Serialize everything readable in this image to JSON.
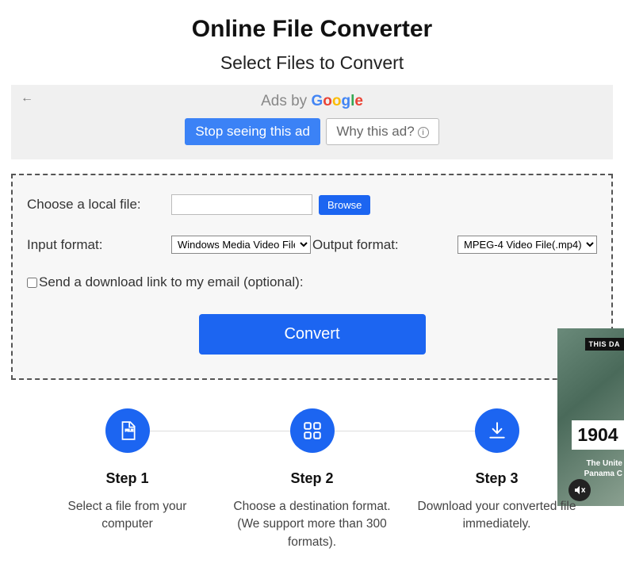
{
  "title": "Online File Converter",
  "subtitle": "Select Files to Convert",
  "ad": {
    "prefix": "Ads by ",
    "stop": "Stop seeing this ad",
    "why": "Why this ad?"
  },
  "form": {
    "choose_label": "Choose a local file:",
    "browse": "Browse",
    "input_format_label": "Input format:",
    "input_format_value": "Windows Media Video File(.wmv)",
    "output_format_label": "Output format:",
    "output_format_value": "MPEG-4 Video File(.mp4)",
    "email_opt": "Send a download link to my email (optional):",
    "convert": "Convert"
  },
  "steps": [
    {
      "title": "Step 1",
      "desc": "Select a file from your computer"
    },
    {
      "title": "Step 2",
      "desc": "Choose a destination format. (We support more than 300 formats)."
    },
    {
      "title": "Step 3",
      "desc": "Download your converted file immediately."
    }
  ],
  "video": {
    "tag": "THIS DA",
    "year": "1904",
    "line1": "The Unite",
    "line2": "Panama C"
  }
}
